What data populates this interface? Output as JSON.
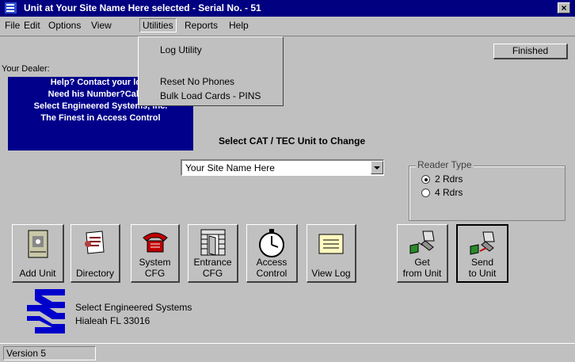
{
  "window": {
    "title": "Unit at Your Site Name Here selected  - Serial No. - 51",
    "close_glyph": "×"
  },
  "menubar": {
    "items": [
      {
        "label": "File"
      },
      {
        "label": "Edit"
      },
      {
        "label": "Options"
      },
      {
        "label": "View"
      },
      {
        "label": "Utilities"
      },
      {
        "label": "Reports"
      },
      {
        "label": "Help"
      }
    ]
  },
  "utilities_menu": {
    "items": [
      {
        "label": "Log Utility"
      },
      {
        "label": "Reset No Phones"
      },
      {
        "label": "Bulk Load Cards - PINS"
      }
    ]
  },
  "finished_button": {
    "label": "Finished"
  },
  "dealer": {
    "label": "Your Dealer:",
    "lines": [
      "Help? Contact  your loca",
      "Need his Number?Call 80",
      "Select Engineered Systems, Inc.",
      "The Finest in Access Control"
    ],
    "bg_color": "#00008b"
  },
  "unit_select": {
    "heading": "Select CAT / TEC Unit to Change",
    "value": "Your Site Name Here"
  },
  "reader_type": {
    "legend": "Reader Type",
    "options": [
      {
        "label": "2 Rdrs",
        "checked": true
      },
      {
        "label": "4 Rdrs",
        "checked": false
      }
    ]
  },
  "toolbar": {
    "add_unit": "Add  Unit",
    "directory": "Directory",
    "system_cfg_1": "System",
    "system_cfg_2": "CFG",
    "entrance_cfg_1": "Entrance",
    "entrance_cfg_2": "CFG",
    "access_control_1": "Access",
    "access_control_2": "Control",
    "view_log": "View Log",
    "get_1": "Get",
    "get_2": "from Unit",
    "send_1": "Send",
    "send_2": "to Unit"
  },
  "company": {
    "name": "Select Engineered Systems",
    "address": "Hialeah FL 33016"
  },
  "status": {
    "version": "Version 5"
  },
  "colors": {
    "titlebar": "#000080",
    "face": "#c0c0c0",
    "logo": "#0000cc"
  }
}
